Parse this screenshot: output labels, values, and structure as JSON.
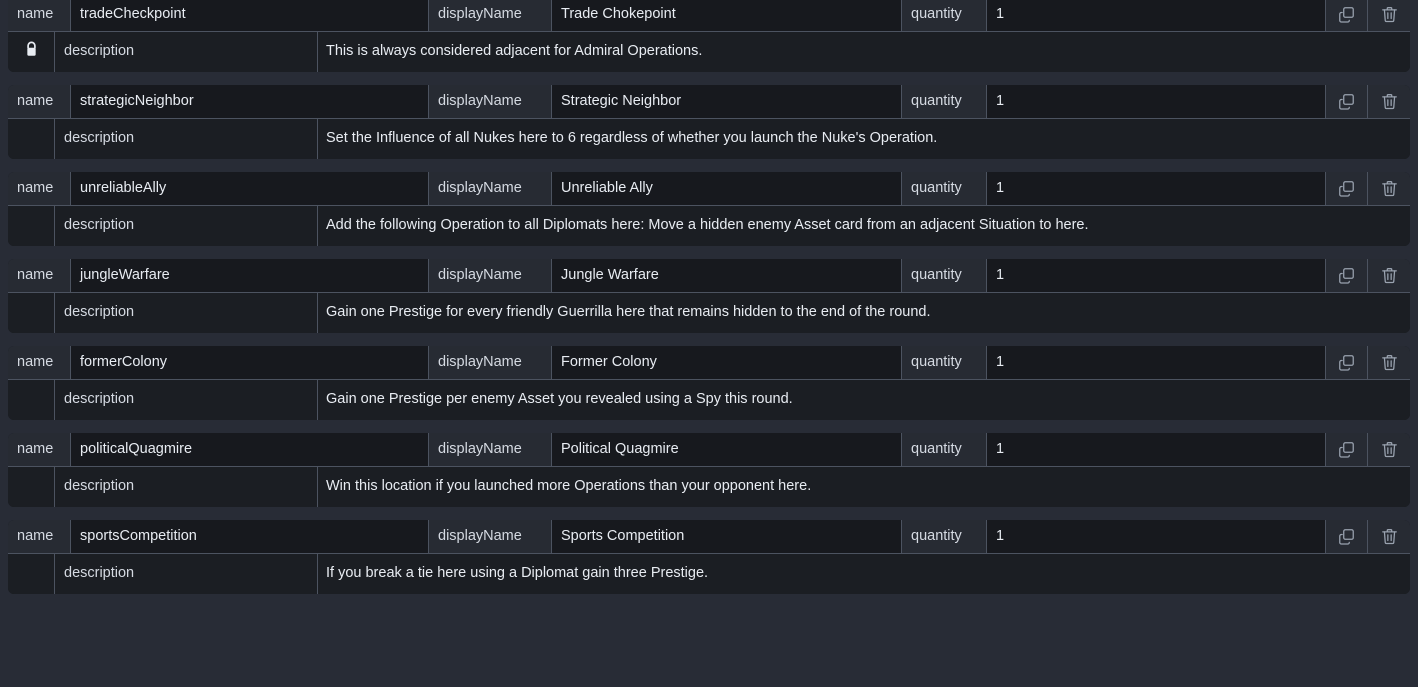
{
  "theme": {
    "page_background": "#282c36",
    "card_background": "#1b1e23",
    "value_background": "#17191e",
    "label_background": "#272b33",
    "border_color": "#4c5360",
    "text_color": "#e8ecf2",
    "label_text_color": "#d5dae2"
  },
  "labels": {
    "name": "name",
    "display_name": "displayName",
    "quantity": "quantity",
    "description": "description"
  },
  "icons": {
    "duplicate": "copy-icon",
    "delete": "trash-icon",
    "locked": "lock-icon"
  },
  "entries": [
    {
      "name": "tradeCheckpoint",
      "displayName": "Trade Chokepoint",
      "quantity": "1",
      "description": "This is always considered adjacent for Admiral Operations.",
      "locked": true,
      "clipped_top": true
    },
    {
      "name": "strategicNeighbor",
      "displayName": "Strategic Neighbor",
      "quantity": "1",
      "description": "Set the Influence of all Nukes here to 6 regardless of whether you launch the Nuke's Operation.",
      "locked": false,
      "clipped_top": false
    },
    {
      "name": "unreliableAlly",
      "displayName": "Unreliable Ally",
      "quantity": "1",
      "description": "Add the following Operation to all Diplomats here: Move a hidden enemy Asset card from an adjacent Situation to here.",
      "locked": false,
      "clipped_top": false
    },
    {
      "name": "jungleWarfare",
      "displayName": "Jungle Warfare",
      "quantity": "1",
      "description": "Gain one Prestige for every friendly Guerrilla here that remains hidden to the end of the round.",
      "locked": false,
      "clipped_top": false
    },
    {
      "name": "formerColony",
      "displayName": "Former Colony",
      "quantity": "1",
      "description": "Gain one Prestige per enemy Asset you revealed using a Spy this round.",
      "locked": false,
      "clipped_top": false
    },
    {
      "name": "politicalQuagmire",
      "displayName": "Political Quagmire",
      "quantity": "1",
      "description": "Win this location if you launched more Operations than your opponent here.",
      "locked": false,
      "clipped_top": false
    },
    {
      "name": "sportsCompetition",
      "displayName": "Sports Competition",
      "quantity": "1",
      "description": "If you break a tie here using a Diplomat gain three Prestige.",
      "locked": false,
      "clipped_top": false
    }
  ]
}
